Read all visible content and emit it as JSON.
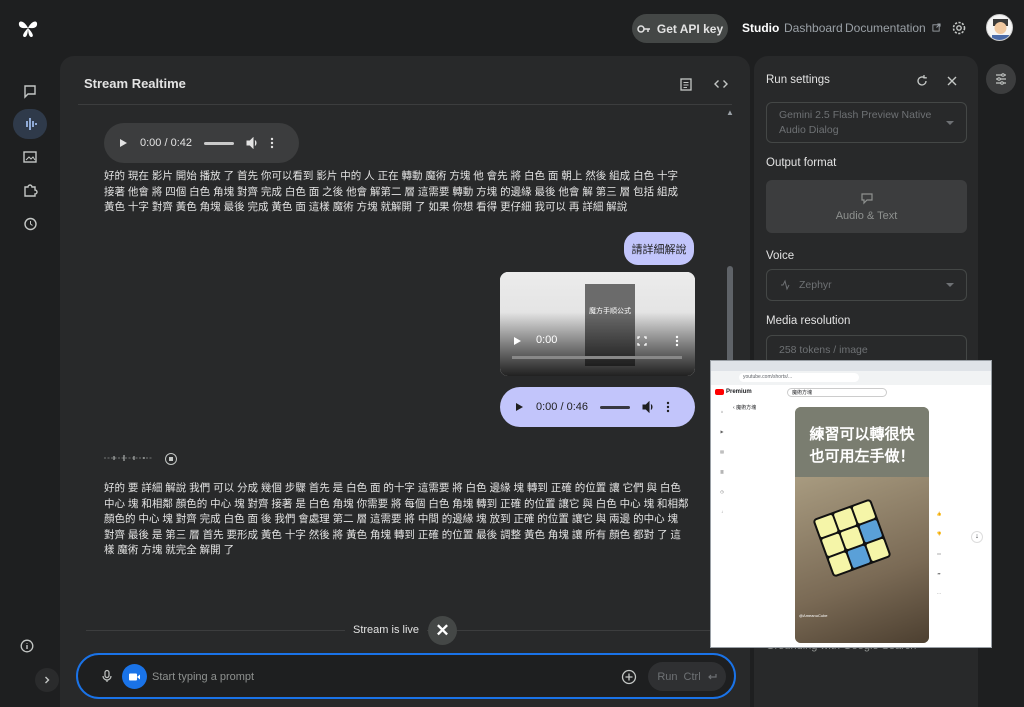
{
  "header": {
    "api_key_label": "Get API key",
    "nav": [
      "Studio",
      "Dashboard",
      "Documentation"
    ]
  },
  "main": {
    "title": "Stream Realtime",
    "model_audio_1": {
      "time": "0:00 / 0:42"
    },
    "model_text_1": "好的 現在 影片 開始 播放 了 首先 你可以看到 影片 中的 人 正在 轉動 魔術 方塊 他 會先 將 白色 面 朝上 然後 組成 白色 十字 接著 他會 將 四個 白色 角塊 對齊 完成 白色 面 之後 他會 解第二 層 這需要 轉動 方塊 的邊緣 最後 他會 解 第三 層 包括 組成 黃色 十字 對齊 黃色 角塊 最後 完成 黃色 面 這樣 魔術 方塊 就解開 了 如果 你想 看得 更仔細 我可以 再 詳細 解說",
    "user_text": "請詳細解說",
    "user_video": {
      "time": "0:00",
      "caption": "魔方手順公式"
    },
    "user_audio": {
      "time": "0:00 / 0:46"
    },
    "model_text_2": "好的 要 詳細 解說 我們 可以 分成 幾個 步驟 首先 是 白色 面 的十字 這需要 將 白色 邊緣 塊 轉到 正確 的位置 讓 它們 與 白色 中心 塊 和相鄰 顏色的 中心 塊 對齊 接著 是 白色 角塊 你需要 將 每個 白色 角塊 轉到 正確 的位置 讓它 與 白色 中心 塊 和相鄰 顏色的 中心 塊 對齊 完成 白色 面 後 我們 會處理 第二 層 這需要 將 中間 的邊緣 塊 放到 正確 的位置 讓它 與 兩邊 的中心 塊 對齊 最後 是 第三 層 首先 要形成 黃色 十字 然後 將 黃色 角塊 轉到 正確 的位置 最後 調整 黃色 角塊 讓 所有 顏色 都對 了 這樣 魔術 方塊 就完全 解開 了",
    "stream_status": "Stream is live",
    "prompt_placeholder": "Start typing a prompt",
    "run_label": "Run",
    "run_shortcut": "Ctrl"
  },
  "settings": {
    "title": "Run settings",
    "model": "Gemini 2.5 Flash Preview Native Audio Dialog",
    "output_format_label": "Output format",
    "output_format": "Audio & Text",
    "voice_label": "Voice",
    "voice": "Zephyr",
    "media_label": "Media resolution",
    "media": "258 tokens / image",
    "bottom_label": "Grounding with Google Search"
  },
  "overlay": {
    "url": "youtube.com/shorts/...",
    "yt_label": "Premium",
    "search": "魔術方塊",
    "back_label": "魔術方塊",
    "caption_line1": "練習可以轉很快",
    "caption_line2": "也可用左手做！",
    "short_bottom": "@AmeanuCube"
  },
  "colors": {
    "accent": "#1a73e8",
    "user_bubble": "#c2c5fb",
    "panel": "#28292a",
    "background": "#1e1f20"
  }
}
